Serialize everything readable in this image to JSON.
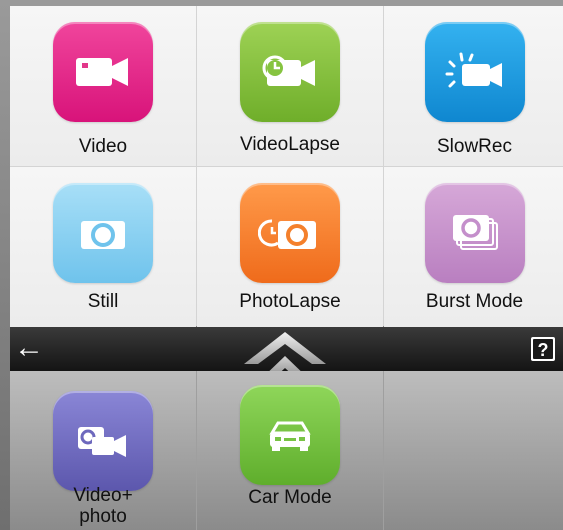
{
  "modes": [
    {
      "label": "Video",
      "icon": "video-camera-icon",
      "color_top": "#f0459c",
      "color_bottom": "#d8137a"
    },
    {
      "label": "VideoLapse",
      "icon": "videolapse-icon",
      "color_top": "#9ed255",
      "color_bottom": "#6fae2a"
    },
    {
      "label": "SlowRec",
      "icon": "slowrec-icon",
      "color_top": "#34b2f0",
      "color_bottom": "#0f87d0"
    },
    {
      "label": "Still",
      "icon": "still-camera-icon",
      "color_top": "#a8dff7",
      "color_bottom": "#6fc3ec"
    },
    {
      "label": "PhotoLapse",
      "icon": "photolapse-icon",
      "color_top": "#ff9a4a",
      "color_bottom": "#ef6b1b"
    },
    {
      "label": "Burst Mode",
      "icon": "burst-mode-icon",
      "color_top": "#d6a8d8",
      "color_bottom": "#b97fc0"
    }
  ],
  "bar": {
    "back_symbol": "←",
    "help_symbol": "?"
  },
  "lower_modes": [
    {
      "label": "Video+\nphoto",
      "icon": "video-plus-photo-icon",
      "color_top": "#8a86d6",
      "color_bottom": "#5c57ad"
    },
    {
      "label": "Car Mode",
      "icon": "car-mode-icon",
      "color_top": "#8fd65a",
      "color_bottom": "#5fae2c"
    }
  ]
}
